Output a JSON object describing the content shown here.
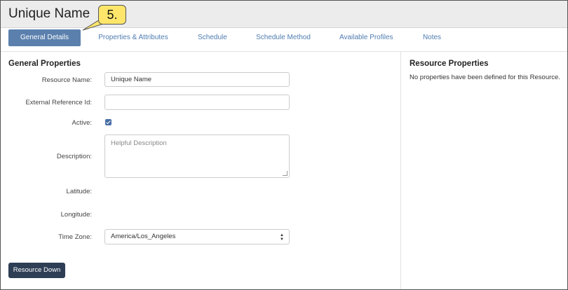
{
  "page": {
    "title": "Unique Name"
  },
  "callout": {
    "label": "5."
  },
  "tabs": [
    {
      "label": "General Details",
      "active": true
    },
    {
      "label": "Properties & Attributes"
    },
    {
      "label": "Schedule"
    },
    {
      "label": "Schedule Method"
    },
    {
      "label": "Available Profiles"
    },
    {
      "label": "Notes"
    }
  ],
  "general": {
    "heading": "General Properties",
    "resource_name": {
      "label": "Resource Name:",
      "value": "Unique Name"
    },
    "external_ref": {
      "label": "External Reference Id:",
      "value": ""
    },
    "active": {
      "label": "Active:",
      "checked": true
    },
    "description": {
      "label": "Description:",
      "placeholder": "Helpful Description"
    },
    "latitude": {
      "label": "Latitude:"
    },
    "longitude": {
      "label": "Longitude:"
    },
    "time_zone": {
      "label": "Time Zone:",
      "value": "America/Los_Angeles"
    }
  },
  "resource_properties": {
    "heading": "Resource Properties",
    "empty_text": "No properties have been defined for this Resource."
  },
  "actions": {
    "resource_down": "Resource Down"
  },
  "colors": {
    "accent": "#5b80ad",
    "dark_button": "#2e3e55",
    "callout": "#ffe66b"
  }
}
